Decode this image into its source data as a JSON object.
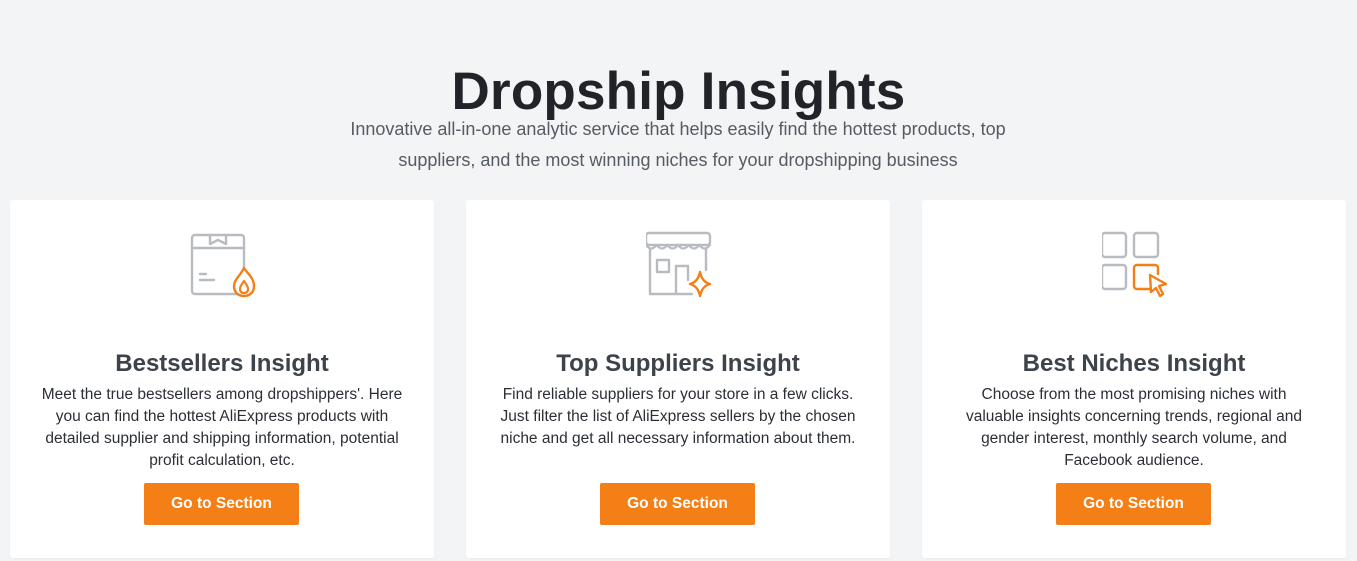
{
  "header": {
    "title": "Dropship Insights",
    "subtitle": "Innovative all-in-one analytic service that helps easily find the hottest products, top suppliers, and the most winning niches for your dropshipping business"
  },
  "colors": {
    "accent": "#f47f16",
    "icon_gray": "#b8bbc0",
    "background": "#f3f4f6",
    "card": "#ffffff"
  },
  "cards": [
    {
      "icon": "box-flame-icon",
      "title": "Bestsellers Insight",
      "description": "Meet the true bestsellers among dropshippers'. Here you can find the hottest AliExpress products with detailed supplier and shipping information, potential profit calculation, etc.",
      "button_label": "Go to Section"
    },
    {
      "icon": "storefront-sparkle-icon",
      "title": "Top Suppliers Insight",
      "description": "Find reliable suppliers for your store in a few clicks. Just filter the list of AliExpress sellers by the chosen niche and get all necessary information about them.",
      "button_label": "Go to Section"
    },
    {
      "icon": "grid-cursor-icon",
      "title": "Best Niches Insight",
      "description": "Choose from the most promising niches with valuable insights concerning trends, regional and gender interest, monthly search volume, and Facebook audience.",
      "button_label": "Go to Section"
    }
  ]
}
